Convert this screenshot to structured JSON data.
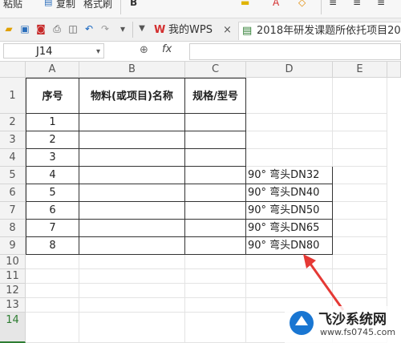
{
  "ribbon": {
    "paste_label": "粘贴",
    "copy_label": "复制",
    "format_painter_label": "格式刷"
  },
  "tabs": [
    {
      "label": "我的WPS",
      "close": "×"
    },
    {
      "label": "2018年研发课题所依托项目20"
    }
  ],
  "formula_bar": {
    "cell_ref": "J14",
    "fx": "fx",
    "value": ""
  },
  "columns": [
    "A",
    "B",
    "C",
    "D",
    "E"
  ],
  "rows": [
    "1",
    "2",
    "3",
    "4",
    "5",
    "6",
    "7",
    "8",
    "9",
    "10",
    "11",
    "12",
    "13",
    "14"
  ],
  "table": {
    "headers": [
      "序号",
      "物料(或项目)名称",
      "规格/型号"
    ],
    "seq": [
      "1",
      "2",
      "3",
      "4",
      "5",
      "6",
      "7",
      "8"
    ]
  },
  "column_d": [
    "",
    "",
    "",
    "",
    "90° 弯头DN32",
    "90° 弯头DN40",
    "90° 弯头DN50",
    "90° 弯头DN65",
    "90° 弯头DN80"
  ],
  "watermark": {
    "title": "飞沙系统网",
    "url": "www.fs0745.com"
  },
  "accent_color": "#2e7d32",
  "arrow_color": "#e53935"
}
